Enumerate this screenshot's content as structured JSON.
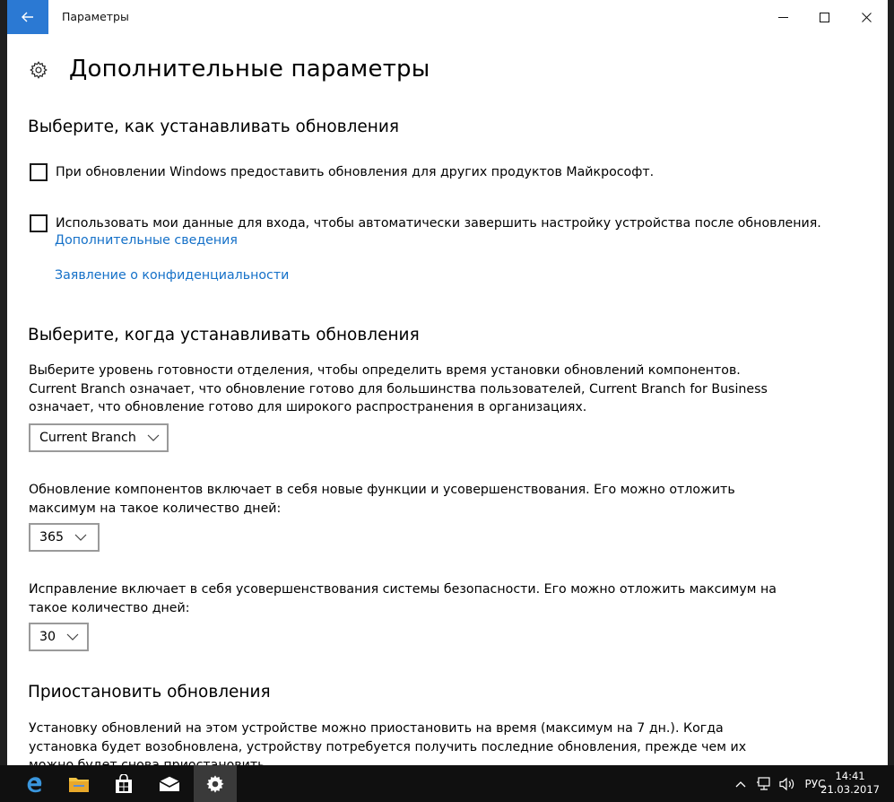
{
  "window": {
    "title": "Параметры"
  },
  "page": {
    "title": "Дополнительные параметры"
  },
  "how_section": {
    "title": "Выберите, как устанавливать обновления",
    "checkbox1_label": "При обновлении Windows предоставить обновления для других продуктов Майкрософт.",
    "checkbox2_label": "Использовать мои данные для входа, чтобы автоматически завершить настройку устройства после обновления.",
    "more_info_link": "Дополнительные сведения",
    "privacy_link": "Заявление о конфиденциальности"
  },
  "when_section": {
    "title": "Выберите, когда устанавливать обновления",
    "branch_description": "Выберите уровень готовности отделения, чтобы определить время установки обновлений компонентов. Current Branch означает, что обновление готово для большинства пользователей, Current Branch for Business означает, что обновление готово для широкого распространения в организациях.",
    "branch_select_value": "Current Branch",
    "feature_description": "Обновление компонентов включает в себя новые функции и усовершенствования. Его можно отложить максимум на такое количество дней:",
    "feature_days_value": "365",
    "quality_description": "Исправление включает в себя усовершенствования системы безопасности. Его можно отложить максимум на такое количество дней:",
    "quality_days_value": "30"
  },
  "pause_section": {
    "title": "Приостановить обновления",
    "description": "Установку обновлений на этом устройстве можно приостановить на время (максимум на 7 дн.). Когда установка будет возобновлена, устройству потребуется получить последние обновления, прежде чем их можно будет снова приостановить."
  },
  "taskbar": {
    "language": "РУС",
    "time": "14:41",
    "date": "21.03.2017"
  },
  "colors": {
    "accent": "#2b79d3",
    "link": "#1470c8",
    "taskbar": "#101010"
  },
  "icons": {
    "back": "arrow-left-icon",
    "minimize": "minimize-icon",
    "maximize": "maximize-icon",
    "close": "close-icon",
    "page": "gear-icon",
    "dropdown": "chevron-down-icon",
    "edge": "edge-icon",
    "explorer": "folder-icon",
    "store": "store-icon",
    "mail": "mail-icon",
    "settings": "gear-icon",
    "tray_chevron": "chevron-up-icon",
    "network": "network-icon",
    "volume": "volume-icon"
  }
}
